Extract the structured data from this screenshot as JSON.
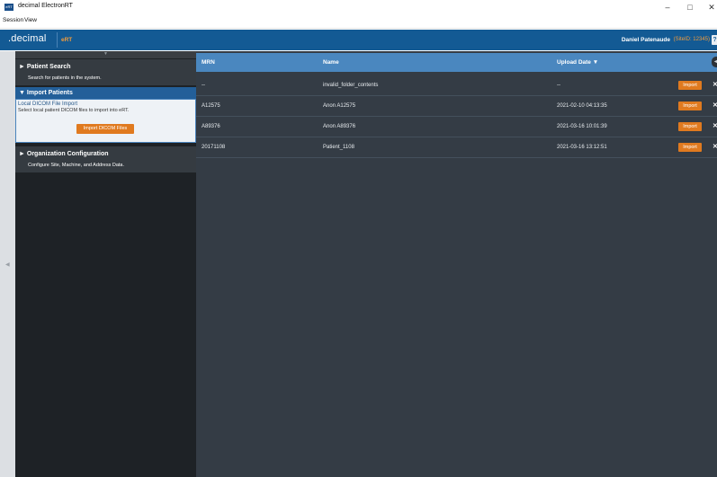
{
  "window": {
    "title": "decimal ElectronRT",
    "icon_name": "app-icon",
    "minimize_glyph": "–",
    "maximize_glyph": "□",
    "close_glyph": "✕"
  },
  "menu": {
    "items": [
      "Session",
      "View"
    ]
  },
  "header": {
    "logo": ".decimal",
    "app_tag": "eRT",
    "user_name": "Daniel Patenaude",
    "site_id": "(SiteID: 12345)",
    "help_label": "?",
    "brand_color": "#135a94",
    "accent_color": "#e07a1f"
  },
  "sidebar": {
    "collapse_glyph": "▼",
    "expand_glyph": "◀",
    "sections": [
      {
        "arrow": "►",
        "title": "Patient Search",
        "description": "Search for patients in the system."
      },
      {
        "arrow": "▼",
        "title": "Import Patients",
        "subsection_title": "Local DICOM File Import",
        "subsection_desc": "Select local patient DICOM files to import into eRT.",
        "button_label": "Import DICOM Files"
      },
      {
        "arrow": "►",
        "title": "Organization Configuration",
        "description": "Configure Site, Machine, and Address Data."
      }
    ]
  },
  "table": {
    "columns": [
      "MRN",
      "Name",
      "Upload Date ▼"
    ],
    "import_label": "Import",
    "row_close_glyph": "✕",
    "right_tab_glyph": "◀",
    "rows": [
      {
        "mrn": "--",
        "name": "invalid_folder_contents",
        "upload_date": "--"
      },
      {
        "mrn": "A12575",
        "name": "Anon A12575",
        "upload_date": "2021-02-10 04:13:35"
      },
      {
        "mrn": "A89376",
        "name": "Anon A89376",
        "upload_date": "2021-03-16 10:01:39"
      },
      {
        "mrn": "20171108",
        "name": "Patient_1108",
        "upload_date": "2021-03-16 13:12:51"
      }
    ]
  }
}
